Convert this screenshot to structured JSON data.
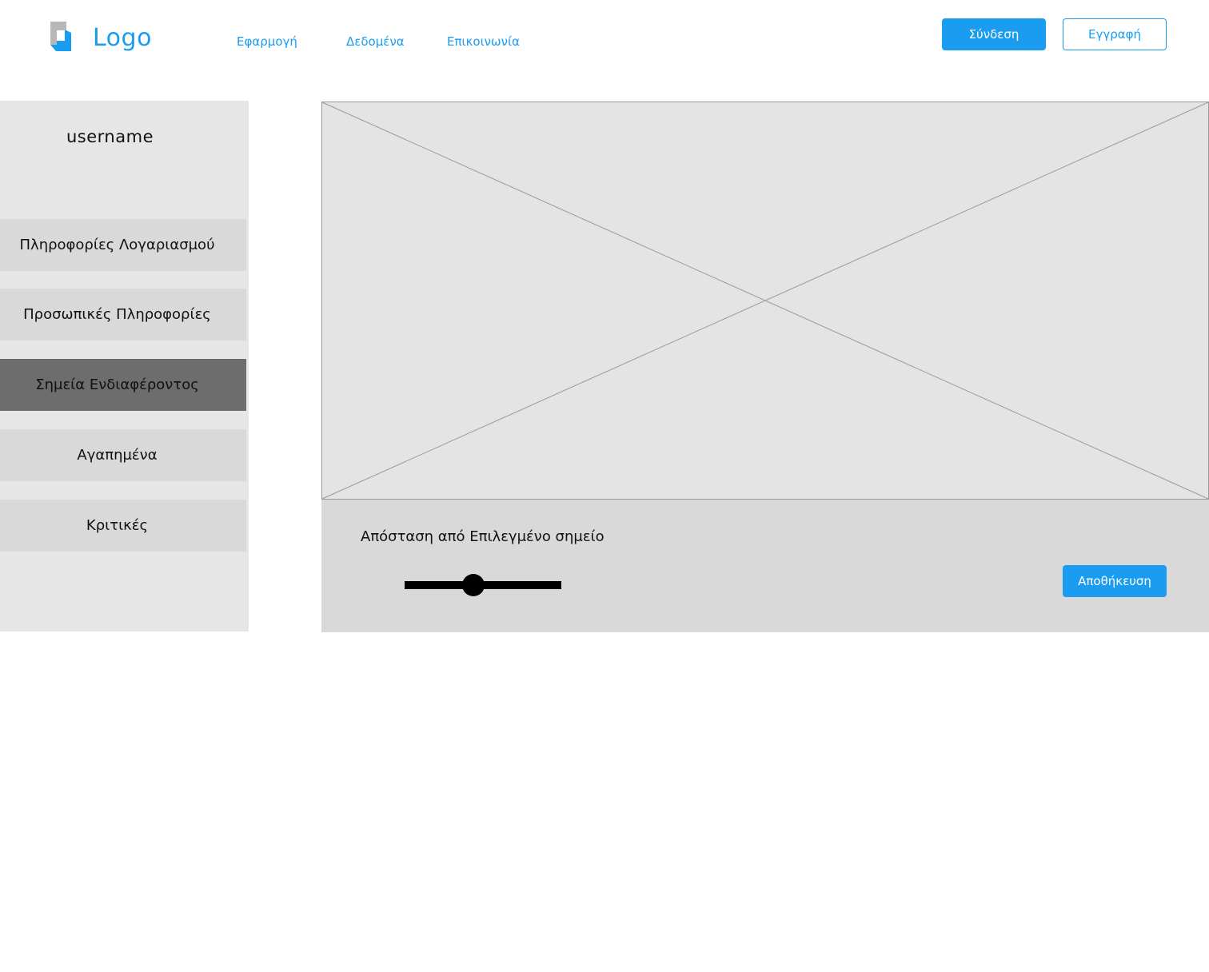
{
  "header": {
    "logo_text": "Logo",
    "nav": [
      {
        "label": "Εφαρμογή"
      },
      {
        "label": "Δεδομένα"
      },
      {
        "label": "Επικοινωνία"
      }
    ],
    "login_label": "Σύνδεση",
    "register_label": "Εγγραφή"
  },
  "sidebar": {
    "username": "username",
    "items": [
      {
        "label": "Πληροφορίες Λογαριασμού",
        "active": false
      },
      {
        "label": "Προσωπικές Πληροφορίες",
        "active": false
      },
      {
        "label": "Σημεία Ενδιαφέροντος",
        "active": true
      },
      {
        "label": "Αγαπημένα",
        "active": false
      },
      {
        "label": "Κριτικές",
        "active": false
      }
    ]
  },
  "controls": {
    "distance_label": "Απόσταση από Επιλεγμένο σημείο",
    "slider_value": 0.44,
    "save_label": "Αποθήκευση"
  },
  "colors": {
    "accent": "#1a9cf0",
    "sidebar_bg": "#e6e6e6",
    "item_bg": "#d9d9d9",
    "item_active_bg": "#6d6d6d",
    "placeholder_bg": "#e4e4e4",
    "panel_bg": "#d9d9d9"
  },
  "icons": {
    "logo": "logo-icon",
    "map": "image-placeholder-icon"
  }
}
